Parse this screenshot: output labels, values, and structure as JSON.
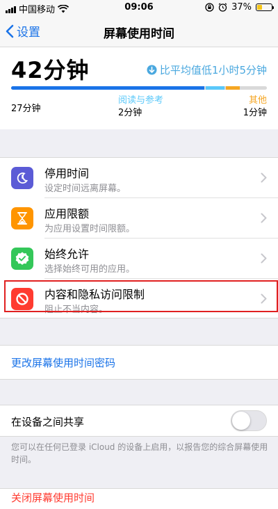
{
  "status_bar": {
    "carrier": "中国移动",
    "time": "09:06",
    "battery": "37%",
    "battery_level": 0.37
  },
  "nav": {
    "back_label": "设置",
    "title": "屏幕使用时间"
  },
  "usage": {
    "total": "42分钟",
    "compare": "比平均值低1小时5分钟",
    "categories": [
      {
        "name": "",
        "time": "27分钟",
        "fraction": 0.76,
        "color": "#1a73e8"
      },
      {
        "name": "阅读与参考",
        "time": "2分钟",
        "fraction": 0.08,
        "color": "#5ac8fa"
      },
      {
        "name": "其他",
        "time": "1分钟",
        "fraction": 0.06,
        "color": "#f5a623"
      }
    ]
  },
  "settings": {
    "items": [
      {
        "title": "停用时间",
        "subtitle": "设定时间远离屏幕。",
        "icon": "downtime-icon",
        "color": "#5b5bd6"
      },
      {
        "title": "应用限额",
        "subtitle": "为应用设置时间限额。",
        "icon": "hourglass-icon",
        "color": "#ff9500"
      },
      {
        "title": "始终允许",
        "subtitle": "选择始终可用的应用。",
        "icon": "checkmark-badge-icon",
        "color": "#34c759"
      },
      {
        "title": "内容和隐私访问限制",
        "subtitle": "阻止不当内容。",
        "icon": "restriction-icon",
        "color": "#ff3b30"
      }
    ]
  },
  "passcode": {
    "label": "更改屏幕使用时间密码"
  },
  "share": {
    "label": "在设备之间共享",
    "enabled": false,
    "note": "您可以在任何已登录 iCloud 的设备上启用，以报告您的综合屏幕使用时间。"
  },
  "turn_off": {
    "label": "关闭屏幕使用时间"
  }
}
